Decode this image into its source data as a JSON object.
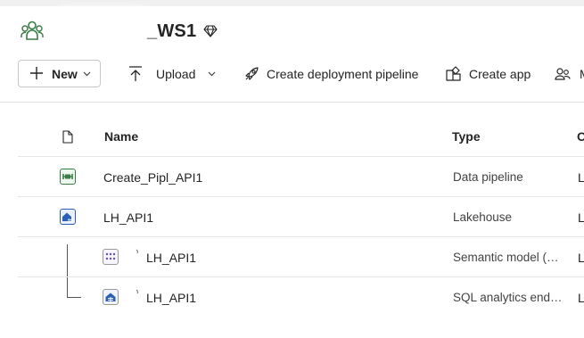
{
  "workspace": {
    "title": "_WS1",
    "icon": "workspace-people-icon",
    "badge_icon": "diamond-icon"
  },
  "toolbar": {
    "new_label": "New",
    "upload_label": "Upload",
    "pipeline_label": "Create deployment pipeline",
    "app_label": "Create app",
    "manage_label": "M"
  },
  "table": {
    "headers": {
      "name": "Name",
      "type": "Type",
      "owner": "O"
    },
    "rows": [
      {
        "name": "Create_Pipl_API1",
        "type": "Data pipeline",
        "owner": "Li",
        "icon": "data-pipeline-icon"
      },
      {
        "name": "LH_API1",
        "type": "Lakehouse",
        "owner": "Li",
        "icon": "lakehouse-icon"
      },
      {
        "name": "LH_API1",
        "type": "Semantic model (…",
        "owner": "Le",
        "icon": "semantic-model-icon"
      },
      {
        "name": "LH_API1",
        "type": "SQL analytics end…",
        "owner": "Le",
        "icon": "sql-endpoint-icon"
      }
    ]
  },
  "colors": {
    "accent_green": "#3a7d44",
    "lakehouse_blue": "#2b5fb4",
    "semantic_purple": "#6a4fb5"
  }
}
